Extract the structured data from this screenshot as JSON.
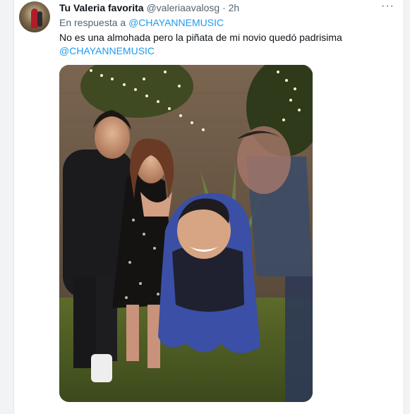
{
  "tweet": {
    "author_name": "Tu Valeria favorita",
    "author_handle": "@valeriaavalosg",
    "separator": "·",
    "time": "2h",
    "more_glyph": "···",
    "reply_prefix": "En respuesta a",
    "reply_mention": "@CHAYANNEMUSIC",
    "text": "No es una almohada pero la piñata de mi novio quedó padrisima",
    "text_mention": "@CHAYANNEMUSIC"
  },
  "colors": {
    "link": "#1d9bf0",
    "text": "#0f1419",
    "muted": "#536471"
  },
  "icons": {
    "more": "more-horizontal-icon"
  }
}
